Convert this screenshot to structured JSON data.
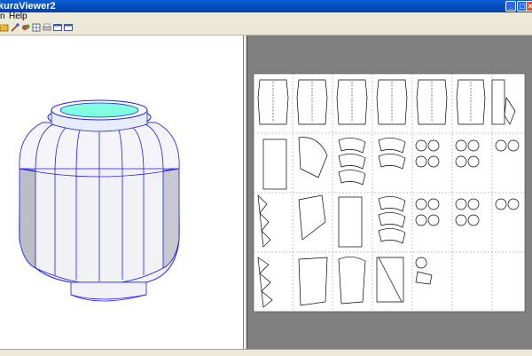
{
  "window": {
    "title": "kuraViewer2"
  },
  "menu": {
    "items": [
      "n",
      "Help"
    ]
  },
  "toolbar": {
    "buttons": [
      {
        "name": "open-file-button",
        "icon": "folder-icon"
      },
      {
        "name": "brush-button",
        "icon": "brush-icon"
      },
      {
        "name": "paint-button",
        "icon": "paint-icon"
      },
      {
        "name": "texture-button",
        "icon": "texture-icon"
      },
      {
        "name": "print-button",
        "icon": "print-icon"
      },
      {
        "name": "view-3d-button",
        "icon": "window-icon"
      },
      {
        "name": "view-2d-button",
        "icon": "window-icon"
      }
    ]
  },
  "colors": {
    "model_edge": "#1a1aff",
    "model_top": "#7fffe0",
    "viewport_bg": "#ffffff",
    "paper_bg": "#808080",
    "sheet": "#ffffff"
  },
  "status": {
    "text": ""
  }
}
